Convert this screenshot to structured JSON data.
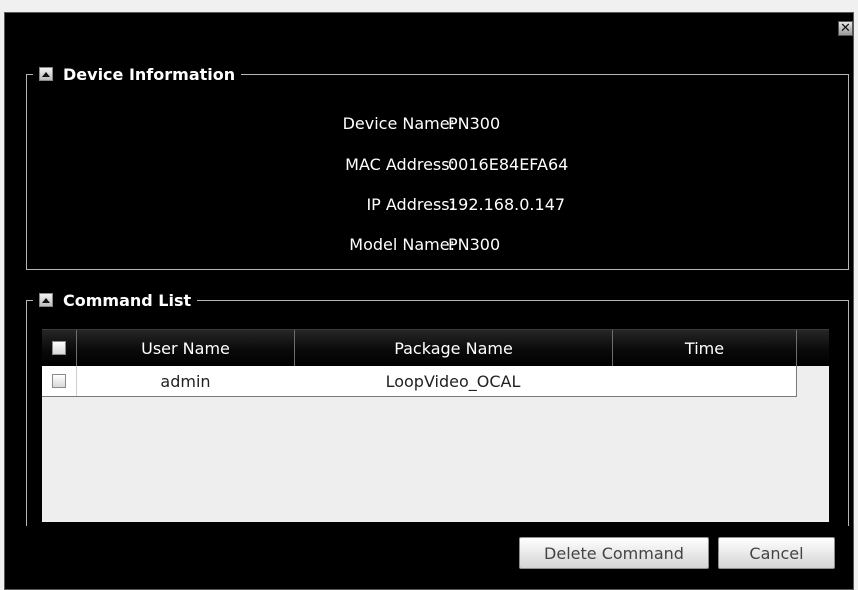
{
  "dialog": {
    "close_icon": "close-icon",
    "close_glyph": "✕"
  },
  "device_info": {
    "title": "Device Information",
    "rows": [
      {
        "label": "Device Name:",
        "value": "PN300"
      },
      {
        "label": "MAC Address:",
        "value": "0016E84EFA64"
      },
      {
        "label": "IP Address:",
        "value": "192.168.0.147"
      },
      {
        "label": "Model Name:",
        "value": "PN300"
      }
    ]
  },
  "command_list": {
    "title": "Command List",
    "columns": [
      "User Name",
      "Package Name",
      "Time"
    ],
    "rows": [
      {
        "checked": false,
        "user_name": "admin",
        "package_name": "LoopVideo_OCAL",
        "time": ""
      }
    ]
  },
  "buttons": {
    "delete": "Delete Command",
    "cancel": "Cancel"
  },
  "colors": {
    "background": "#000000",
    "text": "#ffffff",
    "table_body": "#eeeeee"
  }
}
